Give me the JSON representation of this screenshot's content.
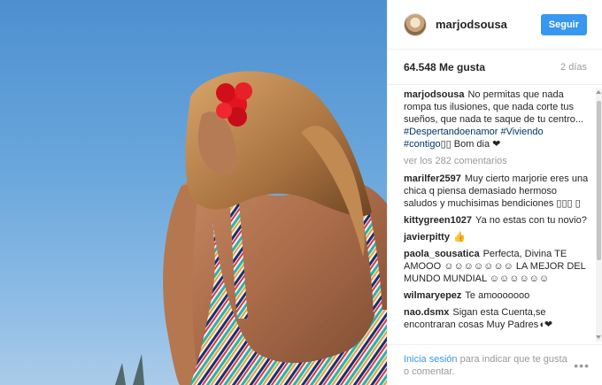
{
  "post": {
    "username": "marjodsousa",
    "follow_label": "Seguir",
    "likes": "64.548 Me gusta",
    "time_ago": "2 días"
  },
  "caption": {
    "user": "marjodsousa",
    "text": "No permitas que nada rompa tus ilusiones, que nada corte tus sueños, que nada te saque de tu centro... ",
    "tag1": "#Despertandoenamor",
    "tag2": "#Viviendo",
    "tag3": "#contigo",
    "tail": "▯▯ Bom dia ❤"
  },
  "view_more": "ver los 282 comentarios",
  "comments": [
    {
      "user": "marilfer2597",
      "text": "Muy cierto marjorie eres una chica q piensa demasiado hermoso saludos y muchisimas bendiciones ▯▯▯ ▯"
    },
    {
      "user": "kittygreen1027",
      "text": "Ya no estas con tu novio?"
    },
    {
      "user": "javierpitty",
      "text": "👍"
    },
    {
      "user": "paola_sousatica",
      "text": "Perfecta, Divina TE AMOOO ☺☺☺☺☺☺☺ LA MEJOR DEL MUNDO MUNDIAL ☺☺☺☺☺☺"
    },
    {
      "user": "wilmaryepez",
      "text": "Te amooooooo"
    },
    {
      "user": "nao.dsmx",
      "text": "Sigan esta Cuenta,se encontraran cosas Muy Padres◖❤"
    }
  ],
  "footer": {
    "login_link": "Inicia sesión",
    "rest": " para indicar que te gusta o comentar.",
    "more_label": "•••"
  },
  "icons": {
    "more": "more-options-icon",
    "avatar": "avatar"
  }
}
